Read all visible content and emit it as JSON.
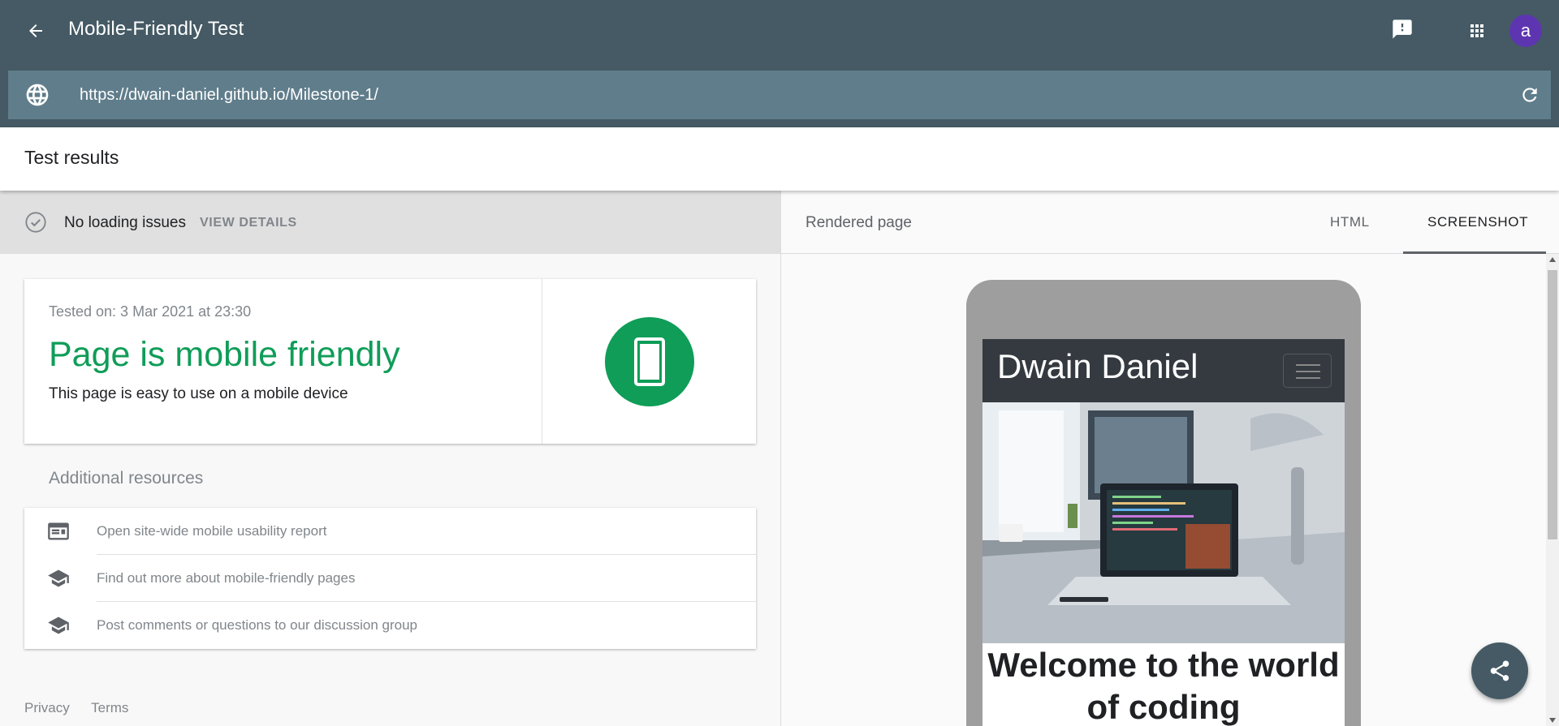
{
  "app": {
    "title": "Mobile-Friendly Test",
    "avatar_letter": "a"
  },
  "url_bar": {
    "value": "https://dwain-daniel.github.io/Milestone-1/"
  },
  "results": {
    "title": "Test results",
    "loading_status": "No loading issues",
    "view_details_label": "VIEW DETAILS",
    "tested_on": "Tested on: 3 Mar 2021 at 23:30",
    "verdict": "Page is mobile friendly",
    "verdict_description": "This page is easy to use on a mobile device"
  },
  "additional_resources": {
    "title": "Additional resources",
    "items": [
      {
        "label": "Open site-wide mobile usability report",
        "icon": "report-icon"
      },
      {
        "label": "Find out more about mobile-friendly pages",
        "icon": "school-icon"
      },
      {
        "label": "Post comments or questions to our discussion group",
        "icon": "school-icon"
      }
    ]
  },
  "footer": {
    "privacy": "Privacy",
    "terms": "Terms"
  },
  "rendered_panel": {
    "label": "Rendered page",
    "tabs": [
      "HTML",
      "SCREENSHOT"
    ],
    "active_tab": "SCREENSHOT"
  },
  "rendered_site": {
    "brand": "Dwain Daniel",
    "heading": "Welcome to the world of coding"
  },
  "colors": {
    "appbar": "#455a64",
    "urlbar": "#607d8b",
    "success_green": "#0f9d58",
    "avatar": "#5e35b1"
  }
}
